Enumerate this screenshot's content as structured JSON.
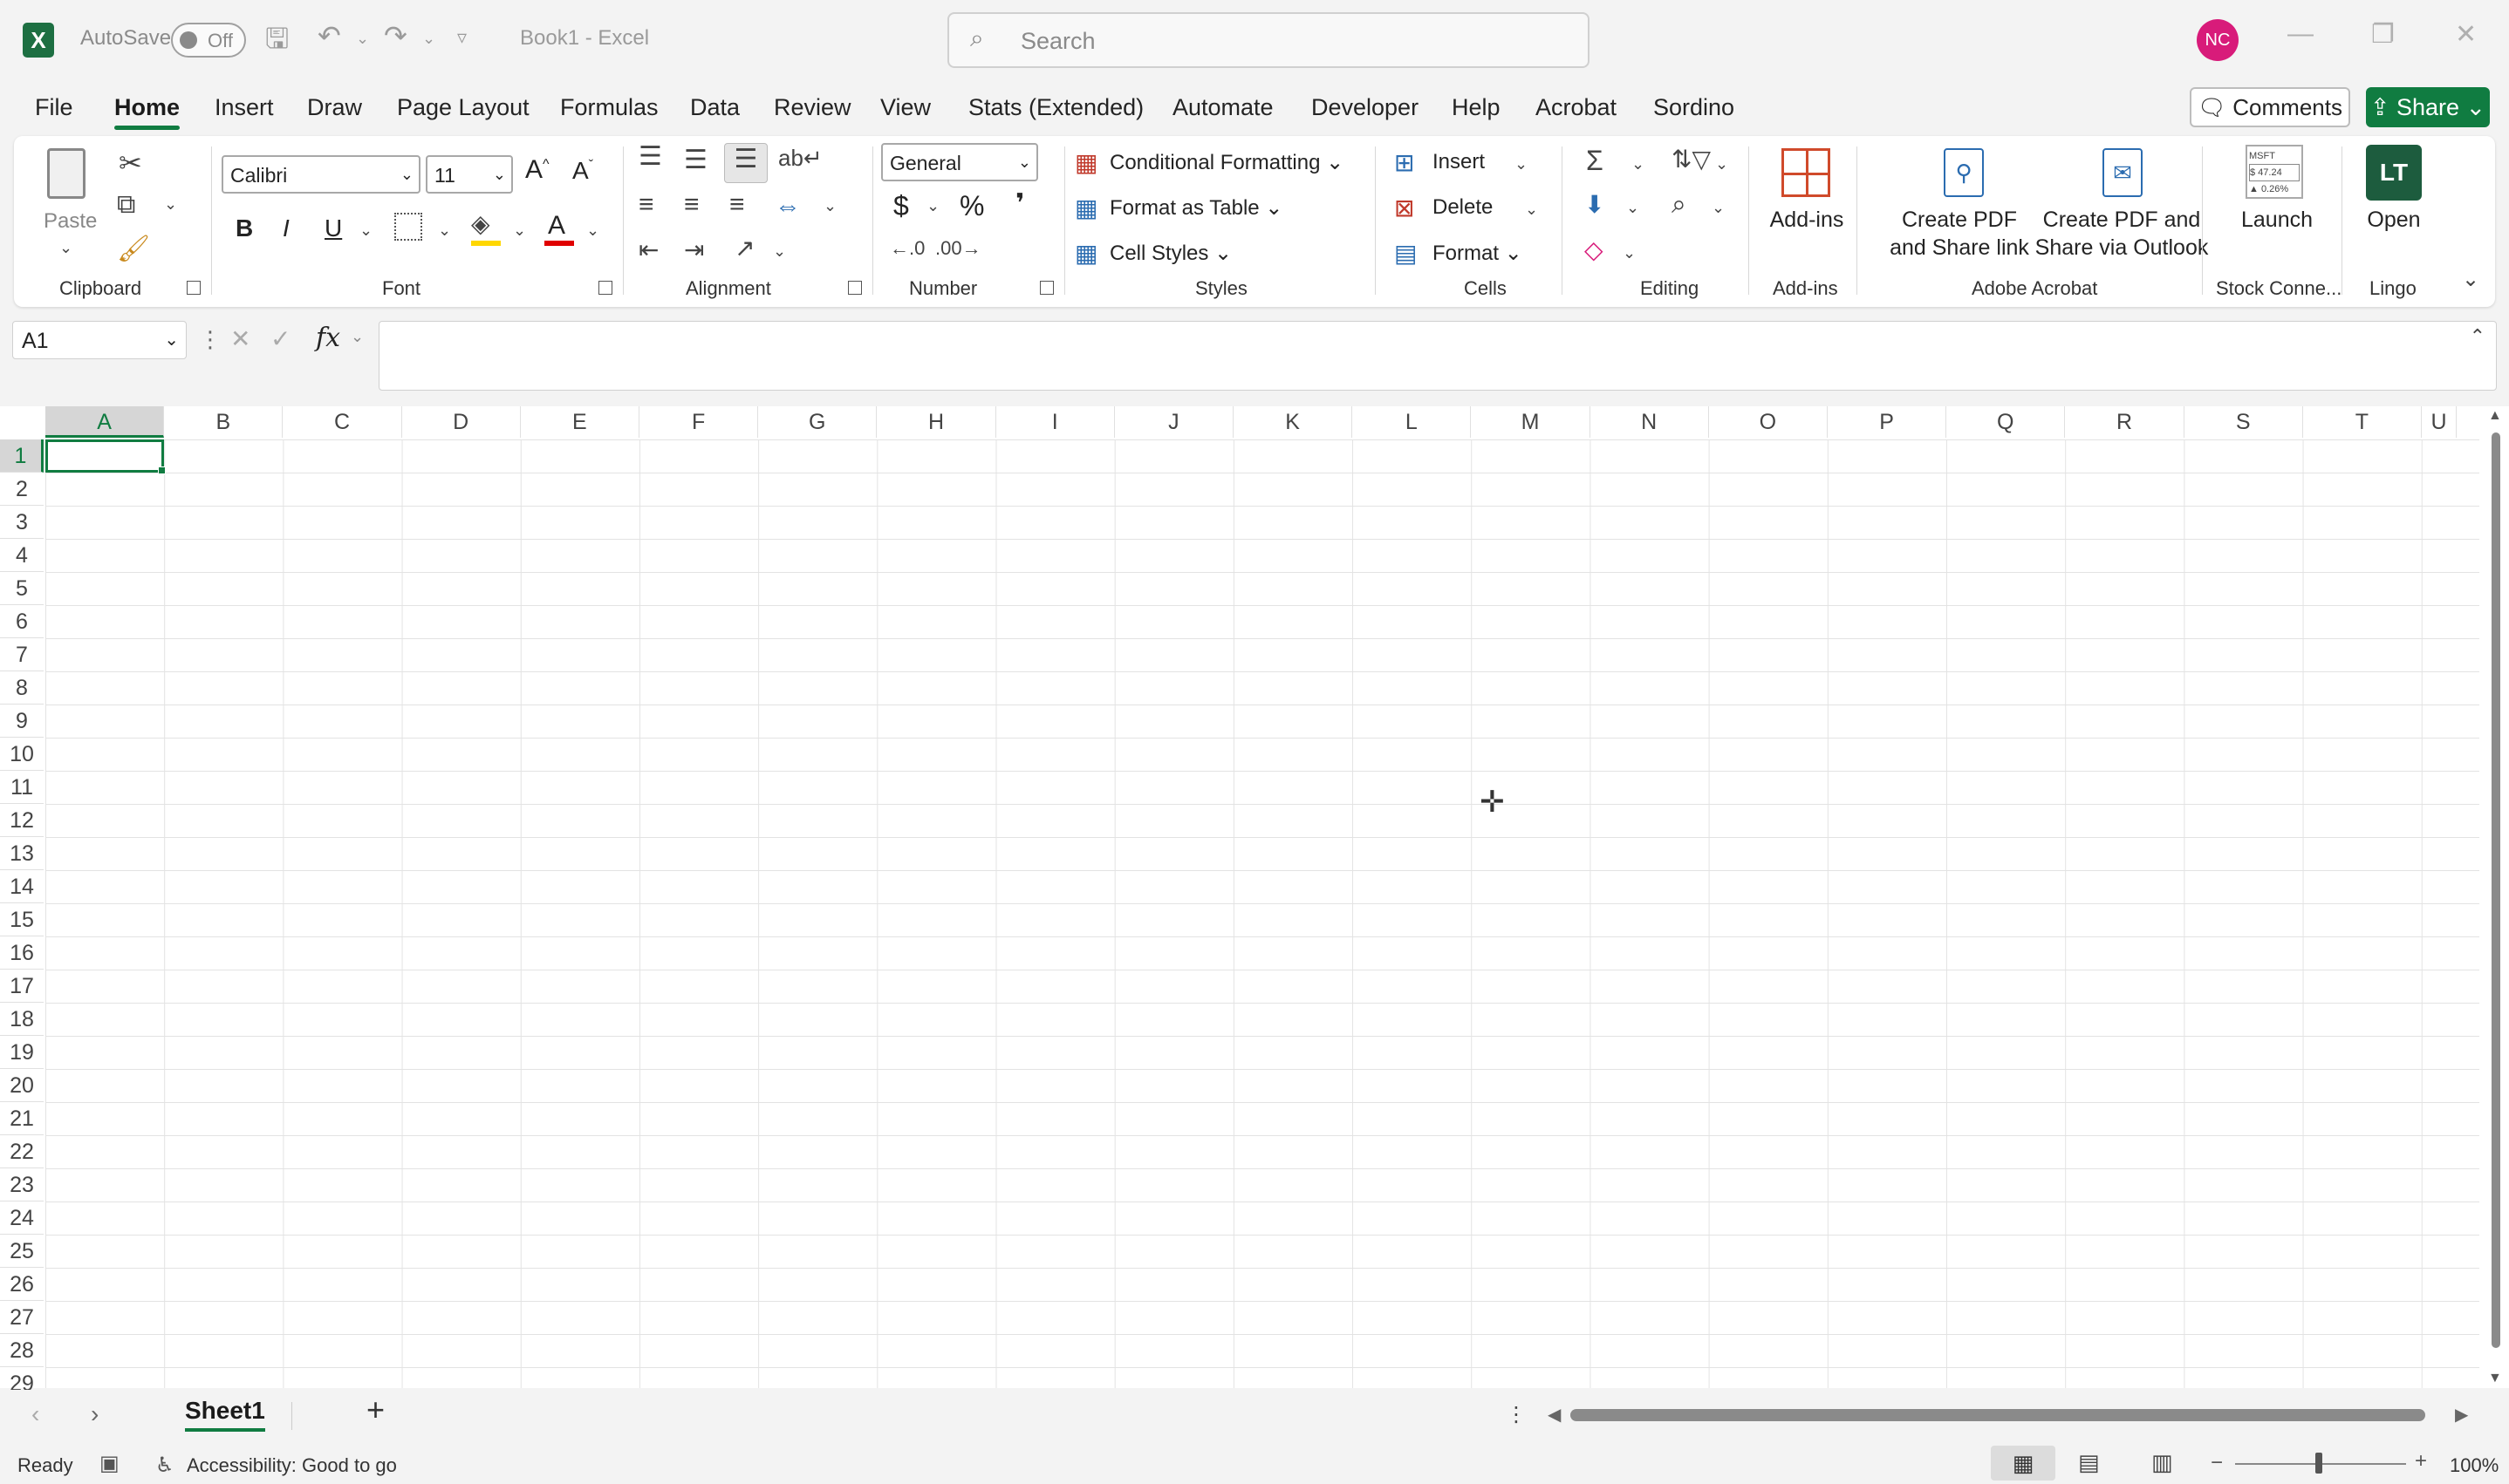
{
  "titlebar": {
    "autosave_label": "AutoSave",
    "autosave_state": "Off",
    "doc_title": "Book1  -  Excel",
    "search_placeholder": "Search",
    "avatar_initials": "NC"
  },
  "tabs": [
    "File",
    "Home",
    "Insert",
    "Draw",
    "Page Layout",
    "Formulas",
    "Data",
    "Review",
    "View",
    "Stats (Extended)",
    "Automate",
    "Developer",
    "Help",
    "Acrobat",
    "Sordino"
  ],
  "actions": {
    "comments": "Comments",
    "share": "Share"
  },
  "ribbon": {
    "clipboard": {
      "paste": "Paste",
      "label": "Clipboard"
    },
    "font": {
      "name": "Calibri",
      "size": "11",
      "bold": "B",
      "italic": "I",
      "underline": "U",
      "grow": "A^",
      "shrink": "Aˇ",
      "label": "Font"
    },
    "alignment": {
      "label": "Alignment"
    },
    "number": {
      "format": "General",
      "currency": "$",
      "percent": "%",
      "comma": "❜",
      "label": "Number"
    },
    "styles": {
      "conditional": "Conditional Formatting",
      "format_table": "Format as Table",
      "cell_styles": "Cell Styles",
      "label": "Styles"
    },
    "cells": {
      "insert": "Insert",
      "delete": "Delete",
      "format": "Format",
      "label": "Cells"
    },
    "editing": {
      "label": "Editing"
    },
    "addins": {
      "button": "Add-ins",
      "label": "Add-ins"
    },
    "acrobat": {
      "create_share": "Create PDF\nand Share link",
      "create_outlook": "Create PDF and\nShare via Outlook",
      "label": "Adobe Acrobat"
    },
    "stock": {
      "launch": "Launch",
      "label": "Stock Conne...",
      "tile_ticker": "MSFT",
      "tile_price": "$ 47.24",
      "tile_change": "▲ 0.26%"
    },
    "lingo": {
      "tile": "LT",
      "open": "Open",
      "label": "Lingo"
    }
  },
  "formulabar": {
    "name_box": "A1",
    "fx": "fx",
    "value": ""
  },
  "columns": [
    "A",
    "B",
    "C",
    "D",
    "E",
    "F",
    "G",
    "H",
    "I",
    "J",
    "K",
    "L",
    "M",
    "N",
    "O",
    "P",
    "Q",
    "R",
    "S",
    "T",
    "U"
  ],
  "rows": [
    "1",
    "2",
    "3",
    "4",
    "5",
    "6",
    "7",
    "8",
    "9",
    "10",
    "11",
    "12",
    "13",
    "14",
    "15",
    "16",
    "17",
    "18",
    "19",
    "20",
    "21",
    "22",
    "23",
    "24",
    "25",
    "26",
    "27",
    "28",
    "29"
  ],
  "sheets": {
    "active": "Sheet1",
    "add": "+"
  },
  "status": {
    "mode": "Ready",
    "accessibility": "Accessibility: Good to go",
    "zoom": "100%"
  }
}
